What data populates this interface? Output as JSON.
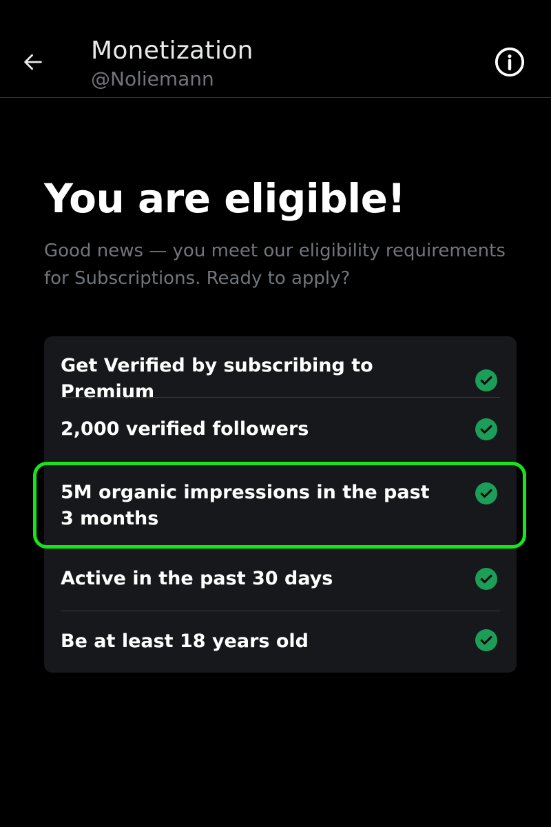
{
  "header": {
    "title": "Monetization",
    "handle": "@Noliemann"
  },
  "main": {
    "heading": "You are eligible!",
    "subtext": "Good news — you meet our eligibility requirements for Subscriptions. Ready to apply?"
  },
  "requirements": [
    {
      "label": "Get Verified by subscribing to Premium",
      "met": true
    },
    {
      "label": "2,000 verified followers",
      "met": true
    },
    {
      "label": "5M organic impressions in the past 3 months",
      "met": true
    },
    {
      "label": "Active in the past 30 days",
      "met": true
    },
    {
      "label": "Be at least 18 years old",
      "met": true
    }
  ],
  "colors": {
    "background": "#000000",
    "card": "#16181c",
    "check_green": "#1d9e58",
    "highlight": "#17e51b",
    "muted_text": "#71767b"
  },
  "icons": {
    "back": "arrow-left-icon",
    "info": "info-icon",
    "check": "check-circle-icon"
  }
}
